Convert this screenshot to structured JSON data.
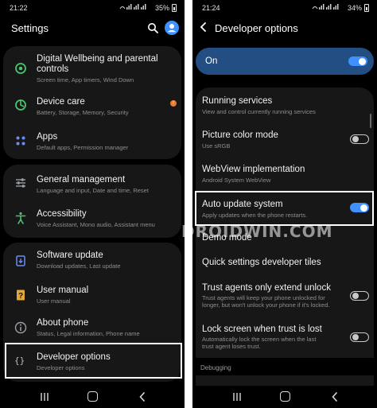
{
  "left_screen": {
    "status": {
      "time": "21:22",
      "battery": "35%"
    },
    "title": "Settings",
    "items": [
      {
        "title_line1": "Digital Wellbeing and parental",
        "title_line2": "controls",
        "subtitle": "Screen time, App timers, Wind Down"
      },
      {
        "title": "Device care",
        "subtitle": "Battery, Storage, Memory, Security",
        "badge": "!"
      },
      {
        "title": "Apps",
        "subtitle": "Default apps, Permission manager"
      },
      {
        "title": "General management",
        "subtitle": "Language and input, Date and time, Reset"
      },
      {
        "title": "Accessibility",
        "subtitle": "Voice Assistant, Mono audio, Assistant menu"
      },
      {
        "title": "Software update",
        "subtitle": "Download updates, Last update"
      },
      {
        "title": "User manual",
        "subtitle": "User manual"
      },
      {
        "title": "About phone",
        "subtitle": "Status, Legal information, Phone name"
      },
      {
        "title": "Developer options",
        "subtitle": "Developer options"
      }
    ]
  },
  "right_screen": {
    "status": {
      "time": "21:24",
      "battery": "34%"
    },
    "title": "Developer options",
    "master": {
      "label": "On",
      "enabled": true
    },
    "items": [
      {
        "title": "Running services",
        "subtitle": "View and control currently running services"
      },
      {
        "title": "Picture color mode",
        "subtitle": "Use sRGB",
        "toggle": false
      },
      {
        "title": "WebView implementation",
        "subtitle": "Android System WebView"
      },
      {
        "title": "Auto update system",
        "subtitle": "Apply updates when the phone restarts.",
        "toggle": true
      },
      {
        "title": "Demo mode"
      },
      {
        "title": "Quick settings developer tiles"
      },
      {
        "title": "Trust agents only extend unlock",
        "subtitle_line1": "Trust agents will keep your phone unlocked for",
        "subtitle_line2": "longer, but won't unlock your phone if it's locked.",
        "toggle": false
      },
      {
        "title": "Lock screen when trust is lost",
        "subtitle_line1": "Automatically lock the screen when the last",
        "subtitle_line2": "trust agent loses trust.",
        "toggle": false
      }
    ],
    "section_debugging": "Debugging"
  },
  "watermark": "DROIDWIN.COM",
  "colors": {
    "background": "#000000",
    "card": "#171717",
    "accent": "#3e91ff",
    "master_card": "#234e83",
    "badge": "#ec7b2c"
  },
  "icons": {
    "left": [
      "wellbeing-icon",
      "device-care-icon",
      "apps-icon",
      "general-management-icon",
      "accessibility-icon",
      "software-update-icon",
      "user-manual-icon",
      "about-phone-icon",
      "developer-options-icon"
    ],
    "top_bar": [
      "search-icon",
      "account-icon",
      "back-arrow-icon"
    ],
    "nav": [
      "recents-icon",
      "home-icon",
      "back-icon"
    ]
  }
}
